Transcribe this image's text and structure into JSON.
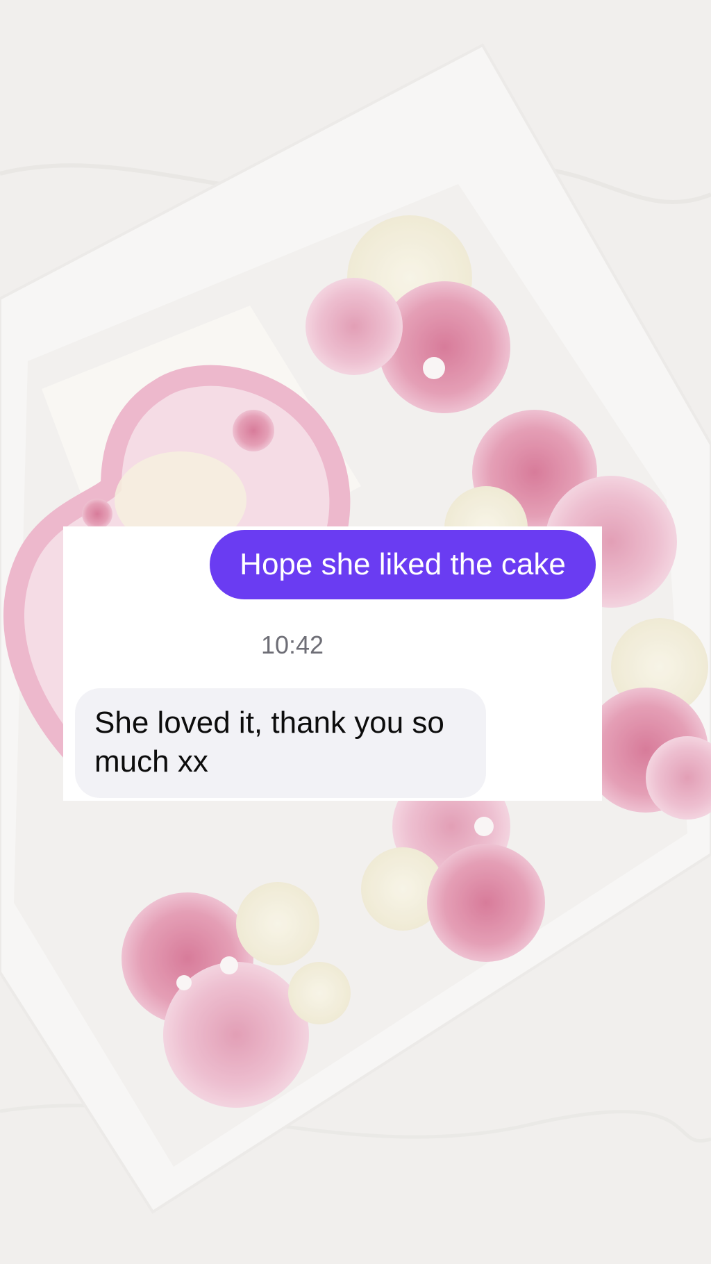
{
  "background": {
    "description_icon": "cupcake-box-photo-icon",
    "colors": {
      "base": "#eeece9",
      "box": "#f7f6f4",
      "frosting_pink": "#e9a7c0",
      "frosting_magenta": "#d9708f",
      "frosting_cream": "#f3efdc"
    }
  },
  "chat": {
    "messages": [
      {
        "direction": "outgoing",
        "text": "Hope she liked the cake"
      },
      {
        "direction": "incoming",
        "text": "She loved it, thank you so much xx"
      }
    ],
    "timestamp": "10:42",
    "colors": {
      "outgoing_bubble": "#6a3cf2",
      "incoming_bubble": "#f2f2f6",
      "timestamp": "#6e6e76"
    }
  }
}
